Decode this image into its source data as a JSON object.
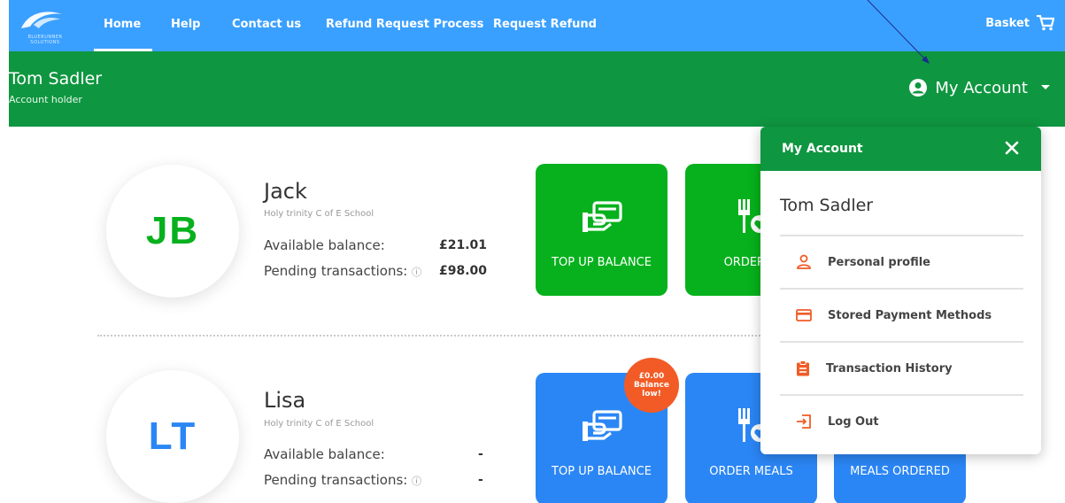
{
  "nav": {
    "logo_text": "BLUERUNNER SOLUTIONS",
    "items": [
      "Home",
      "Help",
      "Contact us",
      "Refund Request Process",
      "Request Refund"
    ],
    "basket_label": "Basket"
  },
  "header": {
    "holder_name": "Tom Sadler",
    "holder_role": "Account holder",
    "my_account_label": "My Account"
  },
  "children": [
    {
      "initials": "JB",
      "name": "Jack",
      "school": "Holy trinity C of E School",
      "available_label": "Available balance:",
      "available_value": "£21.01",
      "pending_label": "Pending transactions:",
      "pending_value": "£98.00",
      "tiles": [
        "TOP UP BALANCE",
        "ORDER M"
      ]
    },
    {
      "initials": "LT",
      "name": "Lisa",
      "school": "Holy trinity C of E School",
      "available_label": "Available balance:",
      "available_value": "-",
      "pending_label": "Pending transactions:",
      "pending_value": "-",
      "tiles": [
        "TOP UP BALANCE",
        "ORDER MEALS",
        "MEALS ORDERED"
      ],
      "badge": {
        "amount": "£0.00",
        "line1": "Balance",
        "line2": "low!"
      }
    }
  ],
  "dropdown": {
    "title": "My Account",
    "user_name": "Tom Sadler",
    "items": [
      "Personal profile",
      "Stored Payment Methods",
      "Transaction History",
      "Log Out"
    ]
  },
  "colors": {
    "nav_blue": "#3aa0ff",
    "header_green": "#0f9640",
    "tile_green": "#07b11d",
    "tile_blue": "#2b86f5",
    "badge_orange": "#f25b26",
    "menu_icon_orange": "#f25b26"
  }
}
